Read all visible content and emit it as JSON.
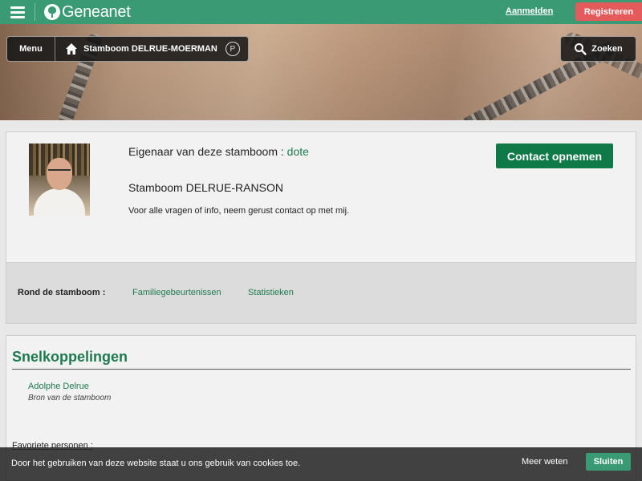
{
  "header": {
    "logo_text": "Geneanet",
    "login_label": "Aanmelden",
    "register_label": "Registreren"
  },
  "banner": {
    "menu_label": "Menu",
    "tree_label": "Stamboom DELRUE-MOERMAN",
    "premium_badge": "P",
    "search_label": "Zoeken"
  },
  "owner": {
    "owner_prefix": "Eigenaar van deze stamboom : ",
    "owner_name": "dote",
    "contact_label": "Contact opnemen",
    "tree_name": "Stamboom DELRUE-RANSON",
    "description": "Voor alle vragen of info, neem gerust contact op met mij."
  },
  "around": {
    "label": "Rond de stamboom :",
    "links": [
      "Familiegebeurtenissen",
      "Statistieken"
    ]
  },
  "quicklinks": {
    "title": "Snelkoppelingen",
    "person_name": "Adolphe Delrue",
    "person_role": "Bron van de stamboom",
    "favorites_label": "Favoriete personen :"
  },
  "cookie": {
    "text": "Door het gebruiken van deze website staat u ons gebruik van cookies toe.",
    "more_label": "Meer weten",
    "close_label": "Sluiten"
  },
  "colors": {
    "brand": "#3a9a73",
    "link": "#1f7a4f",
    "contact": "#0f7a48",
    "register": "#e55a5a"
  },
  "icons": [
    "menu-icon",
    "tree-logo-icon",
    "home-icon",
    "premium-icon",
    "search-icon"
  ]
}
